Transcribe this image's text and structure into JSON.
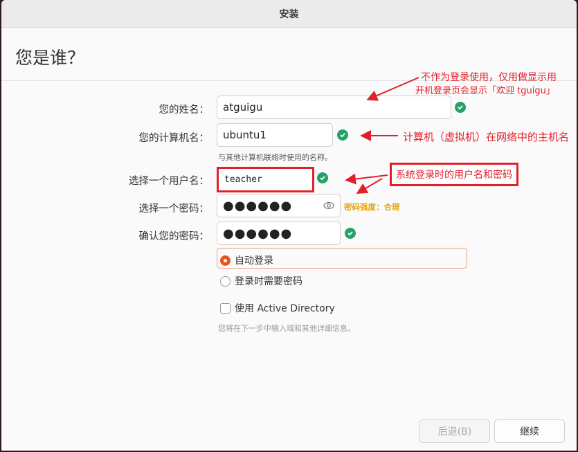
{
  "window": {
    "title": "安装"
  },
  "page": {
    "title": "您是谁？"
  },
  "form": {
    "name_label": "您的姓名：",
    "name_value": "atguigu",
    "computer_label": "您的计算机名：",
    "computer_value": "ubuntu1",
    "computer_hint": "与其他计算机联络时使用的名称。",
    "username_label": "选择一个用户名：",
    "username_value": "teacher",
    "password_label": "选择一个密码：",
    "password_value": "●●●●●●",
    "password_strength": "密码强度：合理",
    "confirm_label": "确认您的密码：",
    "confirm_value": "●●●●●●",
    "auto_login_label": "自动登录",
    "require_password_label": "登录时需要密码",
    "active_directory_label": "使用 Active Directory",
    "active_directory_hint": "您将在下一步中输入域和其他详细信息。"
  },
  "buttons": {
    "back": "后退(B)",
    "continue": "继续"
  },
  "annotations": {
    "name_note_line1": "不作为登录使用，仅用做显示用",
    "name_note_line2": "开机登录页会显示「欢迎 tguigu」",
    "computer_note": "计算机（虚拟机）在网络中的主机名",
    "login_note": "系统登录时的用户名和密码"
  },
  "colors": {
    "accent": "#e95420",
    "check": "#26a269",
    "annotation": "#e0202a",
    "strength": "#e5a50a"
  }
}
